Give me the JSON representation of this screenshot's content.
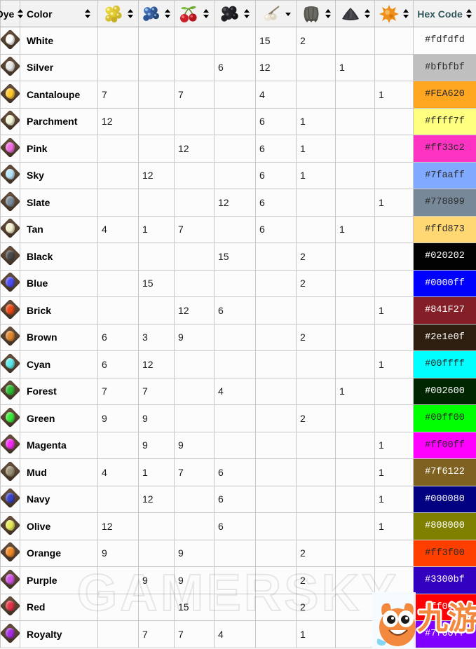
{
  "table": {
    "headers": [
      {
        "key": "dye",
        "label": "Dye",
        "icon": null,
        "sortable": true,
        "arrow": "both"
      },
      {
        "key": "color",
        "label": "Color",
        "icon": null,
        "sortable": true,
        "arrow": "both"
      },
      {
        "key": "n1",
        "label": "",
        "icon": "yellow-berries-icon",
        "sortable": true,
        "arrow": "both"
      },
      {
        "key": "n2",
        "label": "",
        "icon": "blueberries-icon",
        "sortable": true,
        "arrow": "both"
      },
      {
        "key": "n3",
        "label": "",
        "icon": "cherries-icon",
        "sortable": true,
        "arrow": "both"
      },
      {
        "key": "n4",
        "label": "",
        "icon": "blackberries-icon",
        "sortable": true,
        "arrow": "both"
      },
      {
        "key": "n5",
        "label": "",
        "icon": "white-berries-icon",
        "sortable": true,
        "arrow": "down"
      },
      {
        "key": "n6",
        "label": "",
        "icon": "hide-icon",
        "sortable": true,
        "arrow": "both"
      },
      {
        "key": "n7",
        "label": "",
        "icon": "charcoal-icon",
        "sortable": true,
        "arrow": "both"
      },
      {
        "key": "n8",
        "label": "",
        "icon": "orange-ball-icon",
        "sortable": true,
        "arrow": "both"
      },
      {
        "key": "hex",
        "label": "Hex Code",
        "icon": null,
        "sortable": true,
        "arrow": "both"
      }
    ],
    "rows": [
      {
        "color": "White",
        "dye_color": "#fdfdfd",
        "n1": "",
        "n2": "",
        "n3": "",
        "n4": "",
        "n5": "15",
        "n6": "2",
        "n7": "",
        "n8": "",
        "hex": "#fdfdfd",
        "hex_bg": "#fdfdfd",
        "hex_fg": "#2b2b2b"
      },
      {
        "color": "Silver",
        "dye_color": "#e8e8e8",
        "n1": "",
        "n2": "",
        "n3": "",
        "n4": "6",
        "n5": "12",
        "n6": "",
        "n7": "1",
        "n8": "",
        "hex": "#bfbfbf",
        "hex_bg": "#bfbfbf",
        "hex_fg": "#2b2b2b"
      },
      {
        "color": "Cantaloupe",
        "dye_color": "#ffc92e",
        "n1": "7",
        "n2": "",
        "n3": "7",
        "n4": "",
        "n5": "4",
        "n6": "",
        "n7": "",
        "n8": "1",
        "hex": "#FEA620",
        "hex_bg": "#FEA620",
        "hex_fg": "#2b2b2b"
      },
      {
        "color": "Parchment",
        "dye_color": "#f2f4d8",
        "n1": "12",
        "n2": "",
        "n3": "",
        "n4": "",
        "n5": "6",
        "n6": "1",
        "n7": "",
        "n8": "",
        "hex": "#ffff7f",
        "hex_bg": "#ffff7f",
        "hex_fg": "#2b2b2b"
      },
      {
        "color": "Pink",
        "dye_color": "#f06de0",
        "n1": "",
        "n2": "",
        "n3": "12",
        "n4": "",
        "n5": "6",
        "n6": "1",
        "n7": "",
        "n8": "",
        "hex": "#ff33c2",
        "hex_bg": "#ff33c2",
        "hex_fg": "#2b2b2b"
      },
      {
        "color": "Sky",
        "dye_color": "#b8e3f7",
        "n1": "",
        "n2": "12",
        "n3": "",
        "n4": "",
        "n5": "6",
        "n6": "1",
        "n7": "",
        "n8": "",
        "hex": "#7faaff",
        "hex_bg": "#7faaff",
        "hex_fg": "#2b2b2b"
      },
      {
        "color": "Slate",
        "dye_color": "#7b8a99",
        "n1": "",
        "n2": "",
        "n3": "",
        "n4": "12",
        "n5": "6",
        "n6": "",
        "n7": "",
        "n8": "1",
        "hex": "#778899",
        "hex_bg": "#778899",
        "hex_fg": "#2b2b2b"
      },
      {
        "color": "Tan",
        "dye_color": "#f5f0d2",
        "n1": "4",
        "n2": "1",
        "n3": "7",
        "n4": "",
        "n5": "6",
        "n6": "",
        "n7": "1",
        "n8": "",
        "hex": "#ffd873",
        "hex_bg": "#ffd873",
        "hex_fg": "#2b2b2b"
      },
      {
        "color": "Black",
        "dye_color": "#4a4a4a",
        "n1": "",
        "n2": "",
        "n3": "",
        "n4": "15",
        "n5": "",
        "n6": "2",
        "n7": "",
        "n8": "",
        "hex": "#020202",
        "hex_bg": "#020202",
        "hex_fg": "#ffffff"
      },
      {
        "color": "Blue",
        "dye_color": "#4d4df0",
        "n1": "",
        "n2": "15",
        "n3": "",
        "n4": "",
        "n5": "",
        "n6": "2",
        "n7": "",
        "n8": "",
        "hex": "#0000ff",
        "hex_bg": "#0000ff",
        "hex_fg": "#ffffff"
      },
      {
        "color": "Brick",
        "dye_color": "#e84a18",
        "n1": "",
        "n2": "",
        "n3": "12",
        "n4": "6",
        "n5": "",
        "n6": "",
        "n7": "",
        "n8": "1",
        "hex": "#841F27",
        "hex_bg": "#841F27",
        "hex_fg": "#ffffff"
      },
      {
        "color": "Brown",
        "dye_color": "#e08830",
        "n1": "6",
        "n2": "3",
        "n3": "9",
        "n4": "",
        "n5": "",
        "n6": "2",
        "n7": "",
        "n8": "",
        "hex": "#2e1e0f",
        "hex_bg": "#2e1e0f",
        "hex_fg": "#ffffff"
      },
      {
        "color": "Cyan",
        "dye_color": "#5fe8e8",
        "n1": "6",
        "n2": "12",
        "n3": "",
        "n4": "",
        "n5": "",
        "n6": "",
        "n7": "",
        "n8": "1",
        "hex": "#00ffff",
        "hex_bg": "#00ffff",
        "hex_fg": "#2b2b2b"
      },
      {
        "color": "Forest",
        "dye_color": "#2fbb35",
        "n1": "7",
        "n2": "7",
        "n3": "",
        "n4": "4",
        "n5": "",
        "n6": "",
        "n7": "1",
        "n8": "",
        "hex": "#002600",
        "hex_bg": "#002600",
        "hex_fg": "#ffffff"
      },
      {
        "color": "Green",
        "dye_color": "#3de83d",
        "n1": "9",
        "n2": "9",
        "n3": "",
        "n4": "",
        "n5": "",
        "n6": "2",
        "n7": "",
        "n8": "",
        "hex": "#00ff00",
        "hex_bg": "#00ff00",
        "hex_fg": "#2b2b2b"
      },
      {
        "color": "Magenta",
        "dye_color": "#f02df0",
        "n1": "",
        "n2": "9",
        "n3": "9",
        "n4": "",
        "n5": "",
        "n6": "",
        "n7": "",
        "n8": "1",
        "hex": "#ff00ff",
        "hex_bg": "#ff00ff",
        "hex_fg": "#2b2b2b"
      },
      {
        "color": "Mud",
        "dye_color": "#9a9176",
        "n1": "4",
        "n2": "1",
        "n3": "7",
        "n4": "6",
        "n5": "",
        "n6": "",
        "n7": "",
        "n8": "1",
        "hex": "#7f6122",
        "hex_bg": "#7f6122",
        "hex_fg": "#ffffff"
      },
      {
        "color": "Navy",
        "dye_color": "#3b44c4",
        "n1": "",
        "n2": "12",
        "n3": "",
        "n4": "6",
        "n5": "",
        "n6": "",
        "n7": "",
        "n8": "1",
        "hex": "#000080",
        "hex_bg": "#000080",
        "hex_fg": "#ffffff"
      },
      {
        "color": "Olive",
        "dye_color": "#e6ea5a",
        "n1": "12",
        "n2": "",
        "n3": "",
        "n4": "6",
        "n5": "",
        "n6": "",
        "n7": "",
        "n8": "1",
        "hex": "#808000",
        "hex_bg": "#808000",
        "hex_fg": "#ffffff"
      },
      {
        "color": "Orange",
        "dye_color": "#f08a28",
        "n1": "9",
        "n2": "",
        "n3": "9",
        "n4": "",
        "n5": "",
        "n6": "2",
        "n7": "",
        "n8": "",
        "hex": "#ff3f00",
        "hex_bg": "#ff3f00",
        "hex_fg": "#2b2b2b"
      },
      {
        "color": "Purple",
        "dye_color": "#cc55e0",
        "n1": "",
        "n2": "9",
        "n3": "9",
        "n4": "",
        "n5": "",
        "n6": "2",
        "n7": "",
        "n8": "",
        "hex": "#3300bf",
        "hex_bg": "#3300bf",
        "hex_fg": "#ffffff"
      },
      {
        "color": "Red",
        "dye_color": "#e0334a",
        "n1": "",
        "n2": "",
        "n3": "15",
        "n4": "",
        "n5": "",
        "n6": "2",
        "n7": "",
        "n8": "",
        "hex": "#ff0000",
        "hex_bg": "#ff0000",
        "hex_fg": "#ffffff"
      },
      {
        "color": "Royalty",
        "dye_color": "#a42ee0",
        "n1": "",
        "n2": "7",
        "n3": "7",
        "n4": "4",
        "n5": "",
        "n6": "1",
        "n7": "",
        "n8": "",
        "hex": "#7f00ff",
        "hex_bg": "#7f00ff",
        "hex_fg": "#ffffff"
      }
    ]
  },
  "watermark": {
    "text": "GAMERSKY"
  },
  "mascot": {
    "text": "九游"
  }
}
